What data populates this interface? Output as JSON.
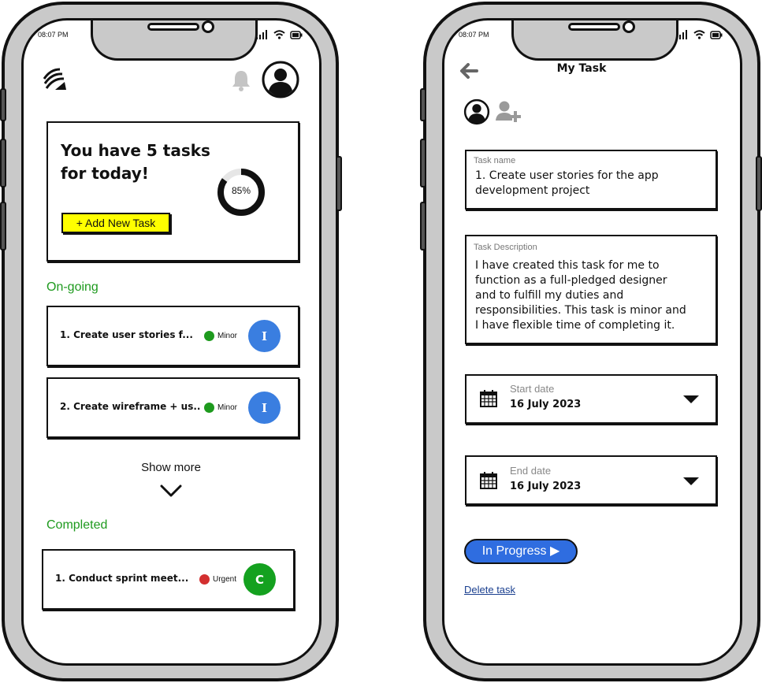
{
  "colors": {
    "accent_green": "#1e9a1e",
    "minor": "#1e9a1e",
    "urgent": "#d32f2f",
    "assignee_blue": "#3a7ee0",
    "assignee_green": "#14a11f",
    "highlight_yellow": "#ffff00",
    "progress_button": "#2f6de0"
  },
  "left": {
    "status_bar": {
      "time": "08:07 PM"
    },
    "header": {
      "logo_icon": "wing-logo-icon",
      "bell_icon": "bell-icon",
      "avatar_icon": "user-avatar-icon"
    },
    "summary": {
      "headline_line1": "You have 5 tasks",
      "headline_line2": "for today!",
      "progress_value": 0.85,
      "progress_label": "85%",
      "add_button": "+ Add New Task"
    },
    "ongoing": {
      "label": "On-going",
      "tasks": [
        {
          "title": "1. Create user stories f...",
          "priority": "Minor",
          "assignee": "I"
        },
        {
          "title": "2. Create wireframe + us..",
          "priority": "Minor",
          "assignee": "I"
        }
      ],
      "show_more": "Show more"
    },
    "completed": {
      "label": "Completed",
      "tasks": [
        {
          "title": "1. Conduct sprint meet...",
          "priority": "Urgent",
          "assignee": "C"
        }
      ]
    }
  },
  "right": {
    "status_bar": {
      "time": "08:07 PM"
    },
    "header": {
      "title": "My Task",
      "back_icon": "arrow-left-icon"
    },
    "members": {
      "user_icon": "user-avatar-icon",
      "add_icon": "add-user-icon"
    },
    "task_name": {
      "label": "Task name",
      "value_line1": "1. Create user stories for the app",
      "value_line2": "development project"
    },
    "task_description": {
      "label": "Task Description",
      "lines": [
        "I have created this task for me to",
        "function as a full-pledged designer",
        "and to fulfill my duties and",
        "responsibilities. This task is minor and",
        "I have flexible time of completing it."
      ]
    },
    "start_date": {
      "label": "Start date",
      "value": "16 July 2023",
      "icon": "calendar-icon"
    },
    "end_date": {
      "label": "End date",
      "value": "16 July 2023",
      "icon": "calendar-icon"
    },
    "status_button": "In Progress ▶",
    "delete_link": "Delete task"
  }
}
